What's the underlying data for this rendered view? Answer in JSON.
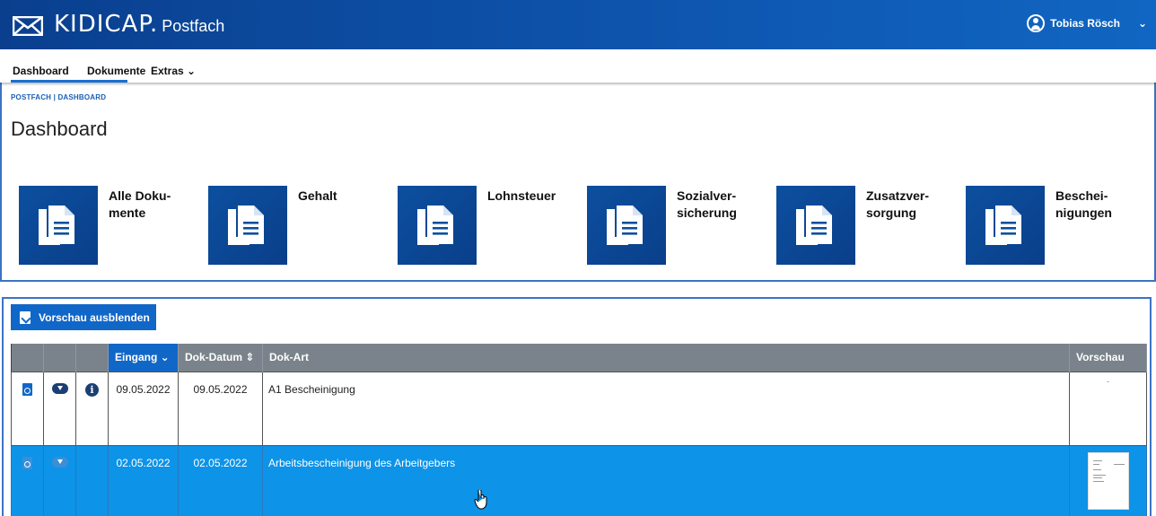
{
  "header": {
    "brand": "KIDICAP.",
    "brand_suffix": "Postfach",
    "user_name": "Tobias Rösch",
    "user_menu_chevron": "⌄"
  },
  "nav": {
    "items": [
      "Dashboard",
      "Dokumente",
      "Extras ⌄"
    ],
    "active": "Dashboard"
  },
  "breadcrumb": "POSTFACH  |  DASHBOARD",
  "page_title": "Dashboard",
  "tiles": [
    {
      "label": "Alle Doku-\nmente",
      "icon": "document-stack-icon"
    },
    {
      "label": "Gehalt",
      "icon": "document-stack-icon"
    },
    {
      "label": "Lohnsteuer",
      "icon": "document-stack-icon"
    },
    {
      "label": "Sozialver-\nsicherung",
      "icon": "document-stack-icon"
    },
    {
      "label": "Zusatzver-\nsorgung",
      "icon": "document-stack-icon"
    },
    {
      "label": "Beschei-\nnigungen",
      "icon": "document-stack-icon"
    }
  ],
  "toolbar": {
    "preview_toggle_label": "Vorschau ausblenden"
  },
  "table": {
    "columns": [
      "",
      "",
      "",
      "Eingang ⌄",
      "Dok-Datum ⇕",
      "Dok-Art",
      "Vorschau"
    ],
    "rows": [
      {
        "eingang": "09.05.2022",
        "dok_datum": "09.05.2022",
        "dok_art": "A1 Bescheinigung",
        "selected": false,
        "info": "i"
      },
      {
        "eingang": "02.05.2022",
        "dok_datum": "02.05.2022",
        "dok_art": "Arbeitsbescheinigung des Arbeitgebers",
        "selected": true,
        "info": ""
      }
    ]
  },
  "colors": {
    "header_start": "#0a3f8e",
    "header_end": "#1066c2",
    "accent": "#1167c8",
    "selected_row": "#0d93e8",
    "table_header": "#7a838b"
  }
}
